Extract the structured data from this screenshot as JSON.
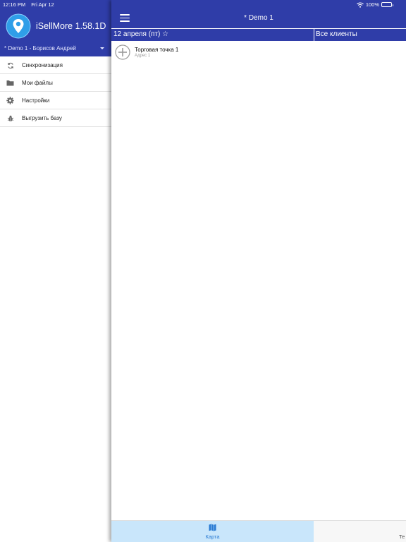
{
  "status_bar": {
    "time": "12:16 PM",
    "date": "Fri Apr 12",
    "battery": "100%"
  },
  "drawer": {
    "app_title": "iSellMore 1.58.1D",
    "account": "* Demo 1 - Борисов Андрей",
    "items": [
      {
        "label": "Синхронизация",
        "icon": "sync-icon"
      },
      {
        "label": "Мои файлы",
        "icon": "folder-icon"
      },
      {
        "label": "Настройки",
        "icon": "gear-icon"
      },
      {
        "label": "Выгрузить базу",
        "icon": "bug-icon"
      }
    ]
  },
  "main": {
    "title": "* Demo 1",
    "filter": {
      "date": "12 апреля (пт) ☆",
      "clients": "Все клиенты"
    },
    "list": [
      {
        "title": "Торговая точка 1",
        "subtitle": "Адрес 1"
      }
    ]
  },
  "tabbar": {
    "tabs": [
      {
        "label": "Карта",
        "icon": "map-icon",
        "active": true
      },
      {
        "label": "Те",
        "icon": "",
        "active": false
      }
    ]
  },
  "colors": {
    "header_blue": "#2f3da8",
    "active_tab_bg": "#c9e6fb",
    "active_tab_fg": "#2a7bd3",
    "logo_blue": "#2f9ee8"
  }
}
